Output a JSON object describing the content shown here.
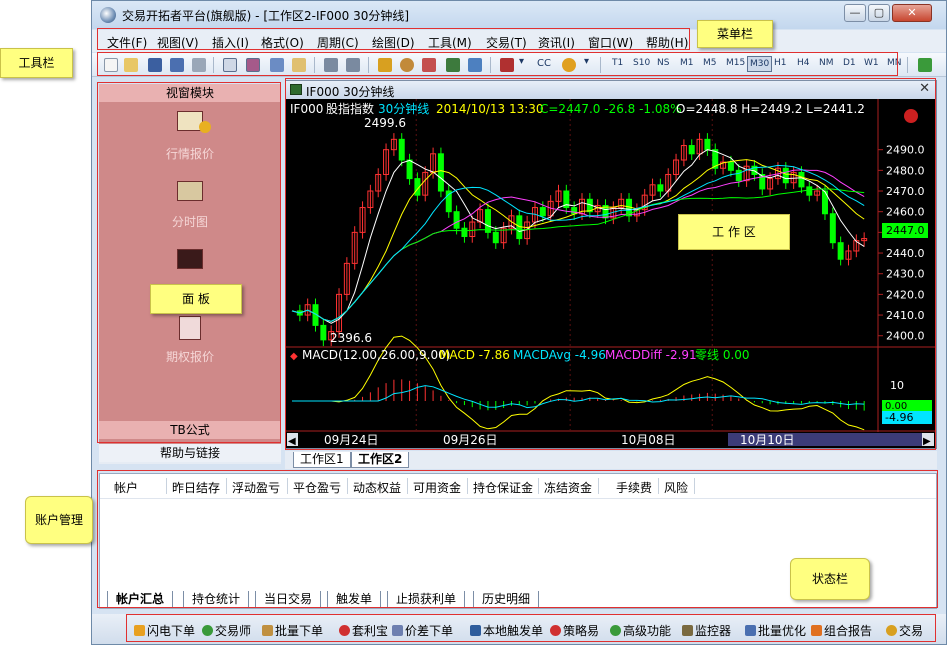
{
  "window": {
    "title": "交易开拓者平台(旗舰版) - [工作区2-IF000 30分钟线]",
    "min_label": "—",
    "max_label": "▢",
    "close_label": "✕"
  },
  "menu": [
    "文件(F)",
    "视图(V)",
    "插入(I)",
    "格式(O)",
    "周期(C)",
    "绘图(D)",
    "工具(M)",
    "交易(T)",
    "资讯(I)",
    "窗口(W)",
    "帮助(H)"
  ],
  "toolbar": {
    "cc_label": "CC",
    "periods": [
      "T1",
      "S10",
      "NS",
      "M1",
      "M5",
      "M15",
      "M30",
      "H1",
      "H4",
      "NM",
      "D1",
      "W1",
      "MN"
    ],
    "selected_period": "M30"
  },
  "left_panel": {
    "header": "视窗模块",
    "items": [
      {
        "label": "行情报价",
        "icon": "quote-board-icon"
      },
      {
        "label": "分时图",
        "icon": "intraday-chart-icon"
      },
      {
        "label": "",
        "icon": "kline-chart-icon"
      },
      {
        "label": "期权报价",
        "icon": "option-quote-icon"
      }
    ],
    "footer": "TB公式",
    "help_link": "帮助与链接"
  },
  "chart": {
    "window_title": "IF000 30分钟线",
    "info": {
      "symbol": "IF000",
      "name": "股指指数",
      "period": "30分钟线",
      "datetime": "2014/10/13 13:30",
      "close_text": "C=2447.0 -26.8 -1.08%",
      "ohl_text": "O=2448.8 H=2449.2 L=2441.2"
    },
    "high_label": "2499.6",
    "low_label": "2396.6",
    "current_price_label": "2447.0",
    "price_axis": [
      "2490.0",
      "2480.0",
      "2470.0",
      "2460.0",
      "2450.0",
      "2440.0",
      "2430.0",
      "2420.0",
      "2410.0",
      "2400.0"
    ],
    "macd": {
      "title": "MACD(12.00,26.00,9.00)",
      "macd": "MACD -7.86",
      "avg": "MACDAvg -4.96",
      "diff": "MACDDiff -2.91",
      "zero": "零线 0.00",
      "axis_label": "10",
      "zero_tag": "0.00",
      "value_tag": "-4.96"
    },
    "date_labels": [
      "09月24日",
      "09月26日",
      "10月08日",
      "10月10日"
    ],
    "colors": {
      "up": "#ff3232",
      "down": "#00ff00",
      "bg": "#000000",
      "text": "#ffffff"
    }
  },
  "work_tabs": [
    {
      "label": "工作区1",
      "active": false
    },
    {
      "label": "工作区2",
      "active": true
    }
  ],
  "account": {
    "columns": [
      "帐户",
      "昨日结存",
      "浮动盈亏",
      "平仓盈亏",
      "动态权益",
      "可用资金",
      "持仓保证金",
      "冻结资金",
      "手续费",
      "风险"
    ],
    "tabs": [
      {
        "label": "帐户汇总",
        "active": true
      },
      {
        "label": "持仓统计",
        "active": false
      },
      {
        "label": "当日交易",
        "active": false
      },
      {
        "label": "触发单",
        "active": false
      },
      {
        "label": "止损获利单",
        "active": false
      },
      {
        "label": "历史明细",
        "active": false
      }
    ]
  },
  "statusbar": [
    "闪电下单",
    "交易师",
    "批量下单",
    "套利宝",
    "价差下单",
    "本地触发单",
    "策略易",
    "高级功能",
    "监控器",
    "批量优化",
    "组合报告",
    "交易"
  ],
  "annotations": {
    "toolbar": "工具栏",
    "menubar": "菜单栏",
    "panel": "面  板",
    "workarea": "工 作 区",
    "account": "账户管理",
    "status": "状态栏"
  }
}
